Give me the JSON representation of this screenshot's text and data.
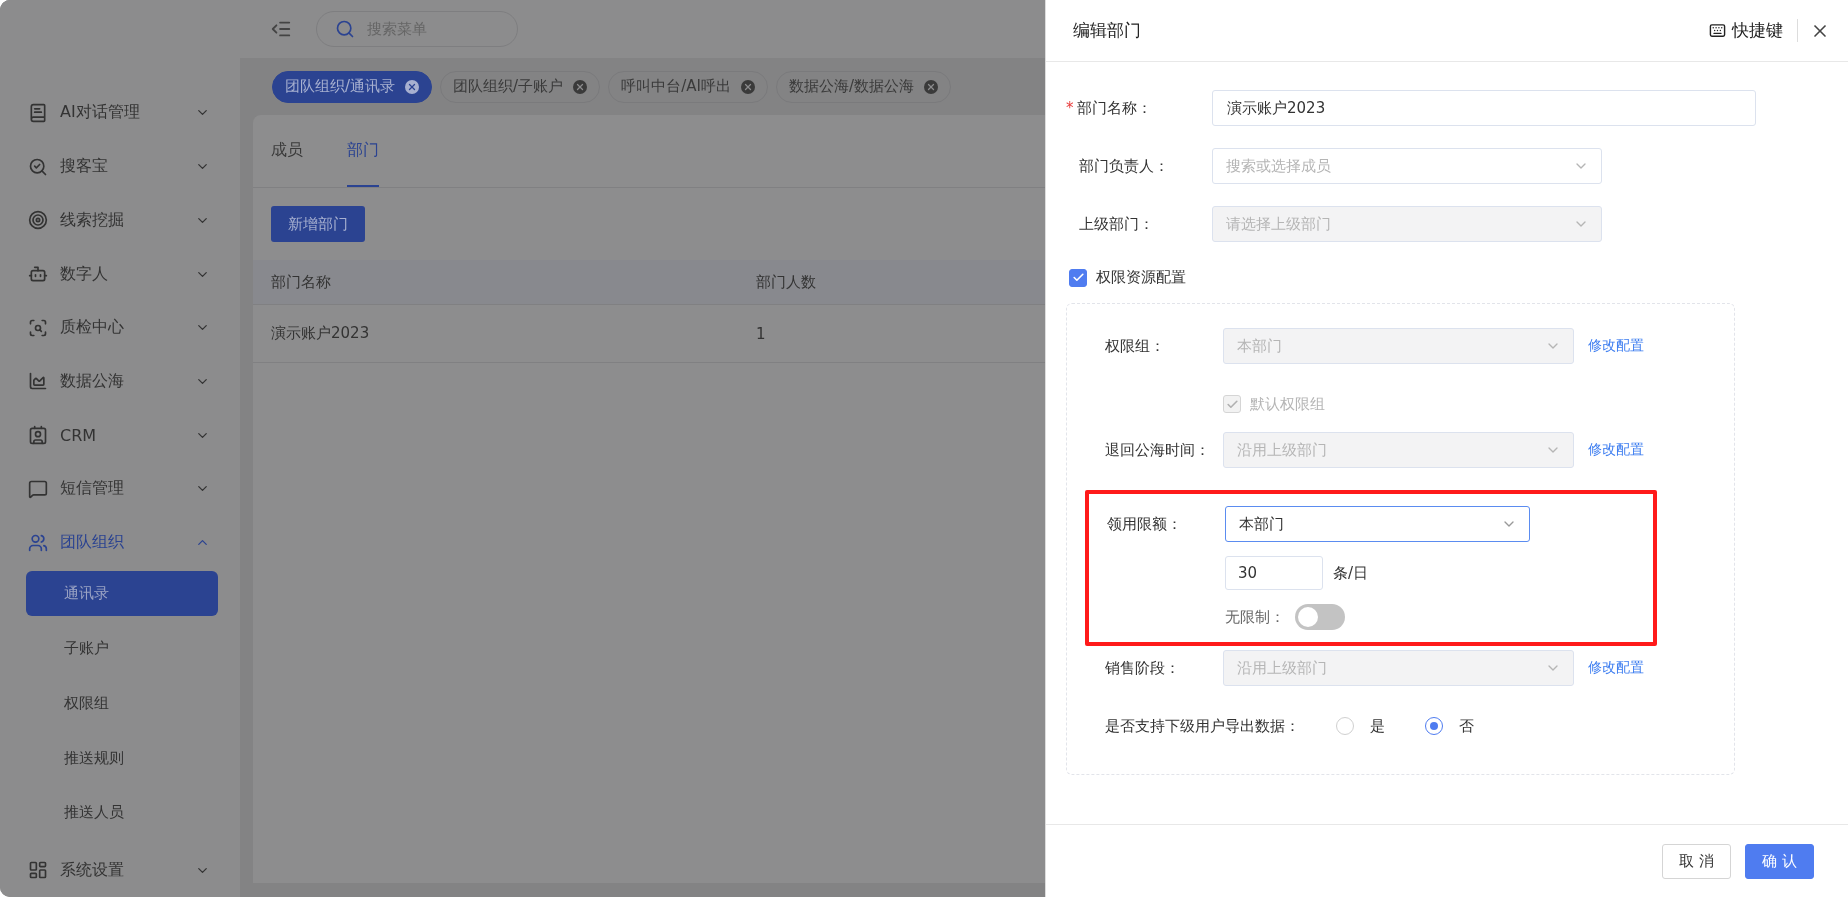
{
  "topbar": {
    "search_placeholder": "搜索菜单"
  },
  "tags": [
    {
      "label": "团队组织/通讯录",
      "selected": true
    },
    {
      "label": "团队组织/子账户",
      "selected": false
    },
    {
      "label": "呼叫中台/AI呼出",
      "selected": false
    },
    {
      "label": "数据公海/数据公海",
      "selected": false
    }
  ],
  "sidebar": {
    "items": [
      {
        "label": "AI对话管理",
        "expanded": false
      },
      {
        "label": "搜客宝",
        "expanded": false
      },
      {
        "label": "线索挖掘",
        "expanded": false
      },
      {
        "label": "数字人",
        "expanded": false
      },
      {
        "label": "质检中心",
        "expanded": false
      },
      {
        "label": "数据公海",
        "expanded": false
      },
      {
        "label": "CRM",
        "expanded": false
      },
      {
        "label": "短信管理",
        "expanded": false
      },
      {
        "label": "团队组织",
        "expanded": true,
        "children": [
          {
            "label": "通讯录",
            "selected": true
          },
          {
            "label": "子账户",
            "selected": false
          },
          {
            "label": "权限组",
            "selected": false
          },
          {
            "label": "推送规则",
            "selected": false
          },
          {
            "label": "推送人员",
            "selected": false
          }
        ]
      },
      {
        "label": "系统设置",
        "expanded": false
      }
    ]
  },
  "page": {
    "tabs": [
      {
        "label": "成员",
        "selected": false
      },
      {
        "label": "部门",
        "selected": true
      }
    ],
    "add_button": "新增部门",
    "table": {
      "columns": [
        "部门名称",
        "部门人数"
      ],
      "rows": [
        [
          "演示账户2023",
          "1"
        ]
      ]
    }
  },
  "drawer": {
    "title": "编辑部门",
    "shortcut": "快捷键",
    "fields": [
      {
        "kind": "input",
        "label": "部门名称：",
        "required_mark": "*",
        "value": "演示账户2023"
      },
      {
        "kind": "select",
        "label": "部门负责人：",
        "placeholder": "搜索或选择成员",
        "disabled": false
      },
      {
        "kind": "select",
        "label": "上级部门：",
        "placeholder": "请选择上级部门",
        "disabled": true
      }
    ],
    "permission": {
      "label": "权限资源配置",
      "checked": true,
      "rows": [
        {
          "kind": "select",
          "label": "权限组：",
          "value": "本部门",
          "disabled": true,
          "link": "修改配置"
        },
        {
          "kind": "checkbox",
          "label": "默认权限组",
          "checked": true,
          "disabled": true
        },
        {
          "kind": "select",
          "label": "退回公海时间：",
          "value": "沿用上级部门",
          "disabled": true,
          "link": "修改配置"
        },
        {
          "kind": "quota",
          "label": "领用限额：",
          "value": "本部门",
          "amount": "30",
          "unit": "条/日",
          "toggle_label": "无限制：",
          "on": false,
          "highlighted": true
        },
        {
          "kind": "select",
          "label": "销售阶段：",
          "value": "沿用上级部门",
          "disabled": true,
          "link": "修改配置"
        },
        {
          "kind": "radio",
          "label": "是否支持下级用户导出数据：",
          "options": [
            {
              "label": "是",
              "selected": false
            },
            {
              "label": "否",
              "selected": true
            }
          ]
        }
      ]
    },
    "footer": {
      "cancel": "取 消",
      "confirm": "确 认"
    }
  }
}
